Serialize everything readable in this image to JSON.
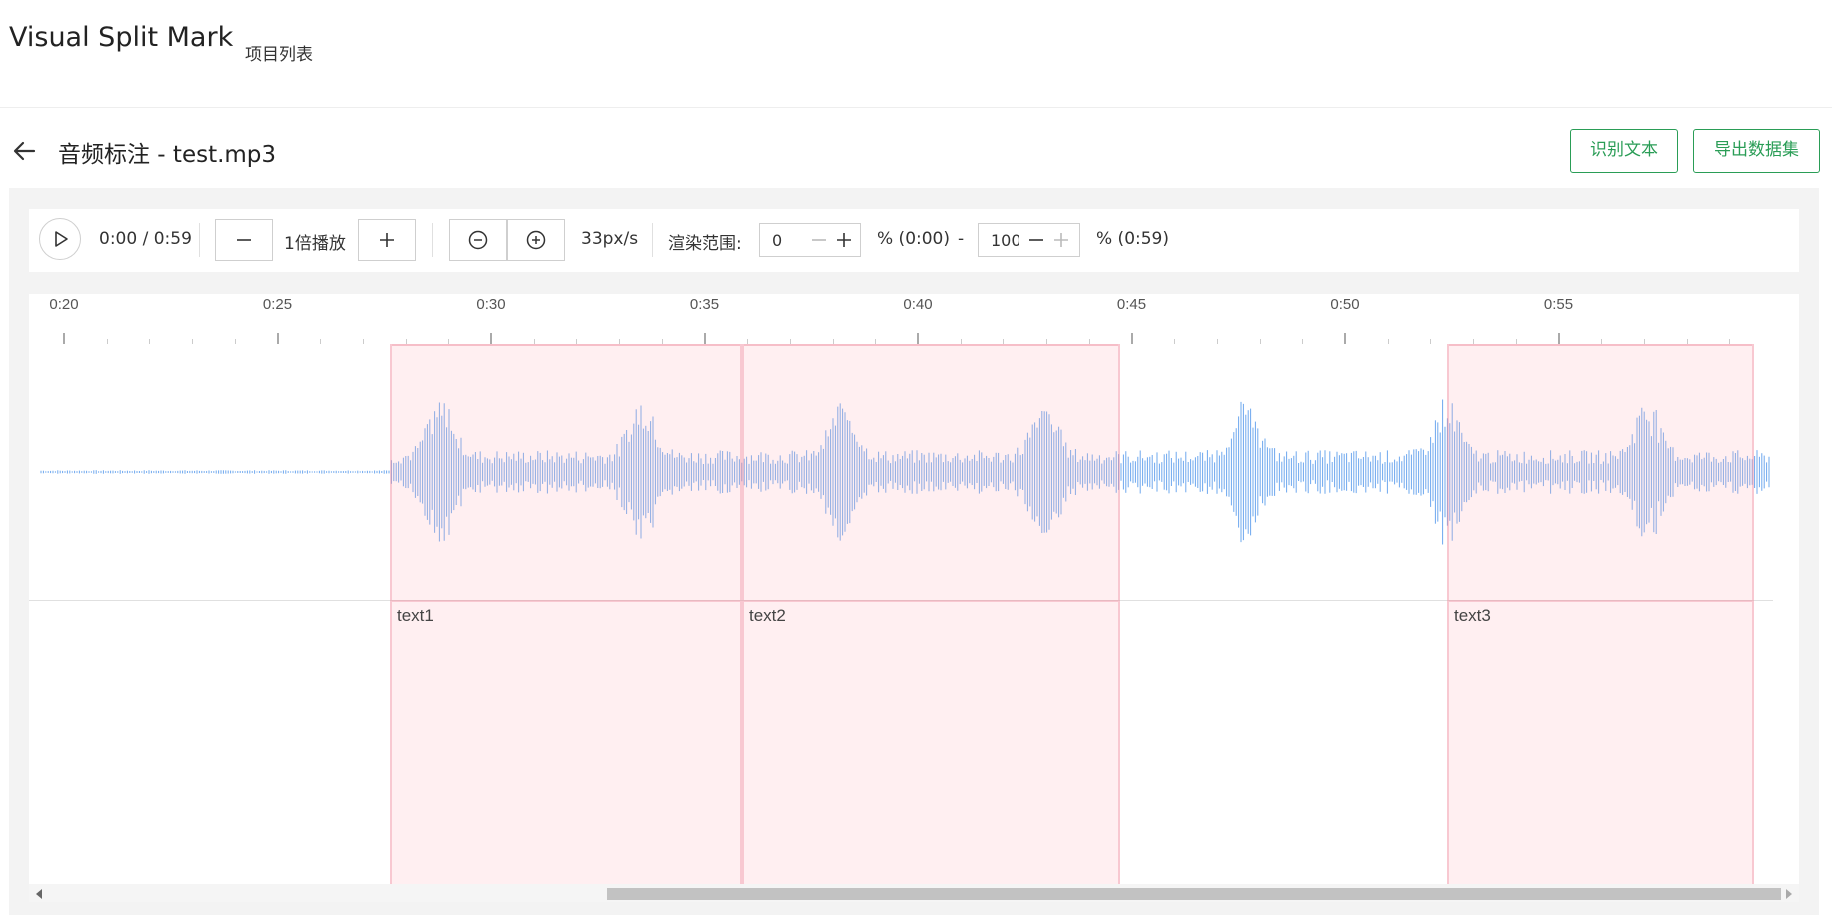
{
  "app": {
    "title": "Visual Split Mark",
    "nav_link": "项目列表"
  },
  "page": {
    "title": "音频标注 - test.mp3",
    "back_icon": "arrow-left-icon"
  },
  "actions": {
    "recognize_label": "识别文本",
    "export_label": "导出数据集",
    "accent_color": "#2a9d56"
  },
  "toolbar": {
    "time": "0:00 / 0:59",
    "speed_label": "1倍播放",
    "zoom_rate": "33px/s",
    "range_label": "渲染范围:",
    "range_start_value": "0",
    "range_start_text": "% (0:00)",
    "range_dash": "-",
    "range_end_value": "100",
    "range_end_text": "% (0:59)"
  },
  "timeline": {
    "ticks": [
      "0:20",
      "0:25",
      "0:30",
      "0:35",
      "0:40",
      "0:45",
      "0:50",
      "0:55"
    ]
  },
  "regions": [
    {
      "label": "text1"
    },
    {
      "label": "text2"
    },
    {
      "label": "text3"
    }
  ],
  "colors": {
    "waveform": "#6ea8ee",
    "region_fill": "#ffe9ee"
  }
}
